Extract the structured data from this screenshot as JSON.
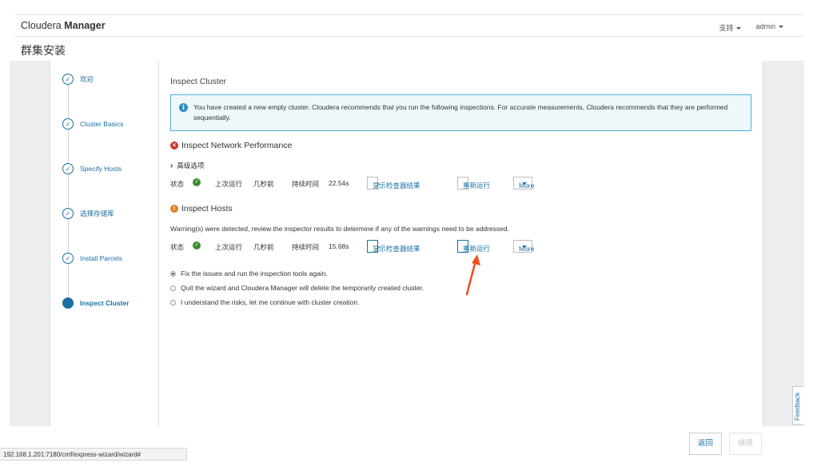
{
  "header": {
    "brand_light": "Cloudera",
    "brand_bold": "Manager",
    "support": "支持",
    "user": "admin"
  },
  "page_title": "群集安装",
  "steps": [
    {
      "label": "欢迎",
      "state": "done"
    },
    {
      "label": "Cluster Basics",
      "state": "done"
    },
    {
      "label": "Specify Hosts",
      "state": "done"
    },
    {
      "label": "选择存储库",
      "state": "done"
    },
    {
      "label": "Install Parcels",
      "state": "done"
    },
    {
      "label": "Inspect Cluster",
      "state": "active"
    }
  ],
  "main": {
    "section_title": "Inspect Cluster",
    "info_text": "You have created a new empty cluster. Cloudera recommends that you run the following inspections. For accurate measurements, Cloudera recommends that they are performed sequentially.",
    "network": {
      "title": "Inspect Network Performance",
      "advanced": "高级选项",
      "status_label": "状态",
      "last_run_label": "上次运行",
      "last_run_value": "几秒前",
      "duration_label": "持续时间",
      "duration_value": "22.54s",
      "show_results": "显示检查器结果",
      "rerun": "重新运行",
      "more": "More"
    },
    "hosts": {
      "title": "Inspect Hosts",
      "warning": "Warning(s) were detected, review the inspector results to determine if any of the warnings need to be addressed.",
      "status_label": "状态",
      "last_run_label": "上次运行",
      "last_run_value": "几秒前",
      "duration_label": "持续时间",
      "duration_value": "15.68s",
      "show_results": "显示检查器结果",
      "rerun": "重新运行",
      "more": "More"
    },
    "options": [
      {
        "label": "Fix the issues and run the inspection tools again.",
        "selected": true
      },
      {
        "label": "Quit the wizard and Cloudera Manager will delete the temporarily created cluster.",
        "selected": false
      },
      {
        "label": "I understand the risks, let me continue with cluster creation.",
        "selected": false
      }
    ]
  },
  "feedback": "Feedback",
  "footer": {
    "back": "返回",
    "next": "继续"
  },
  "statusbar_url": "192.168.1.201:7180/cmf/express-wizard/wizard#",
  "colors": {
    "accent": "#1a6fa0",
    "info_border": "#4cb2d0",
    "error": "#c0392b",
    "warning": "#e67e22",
    "success": "#3c8d2f",
    "annotation_arrow": "#f0501e"
  }
}
